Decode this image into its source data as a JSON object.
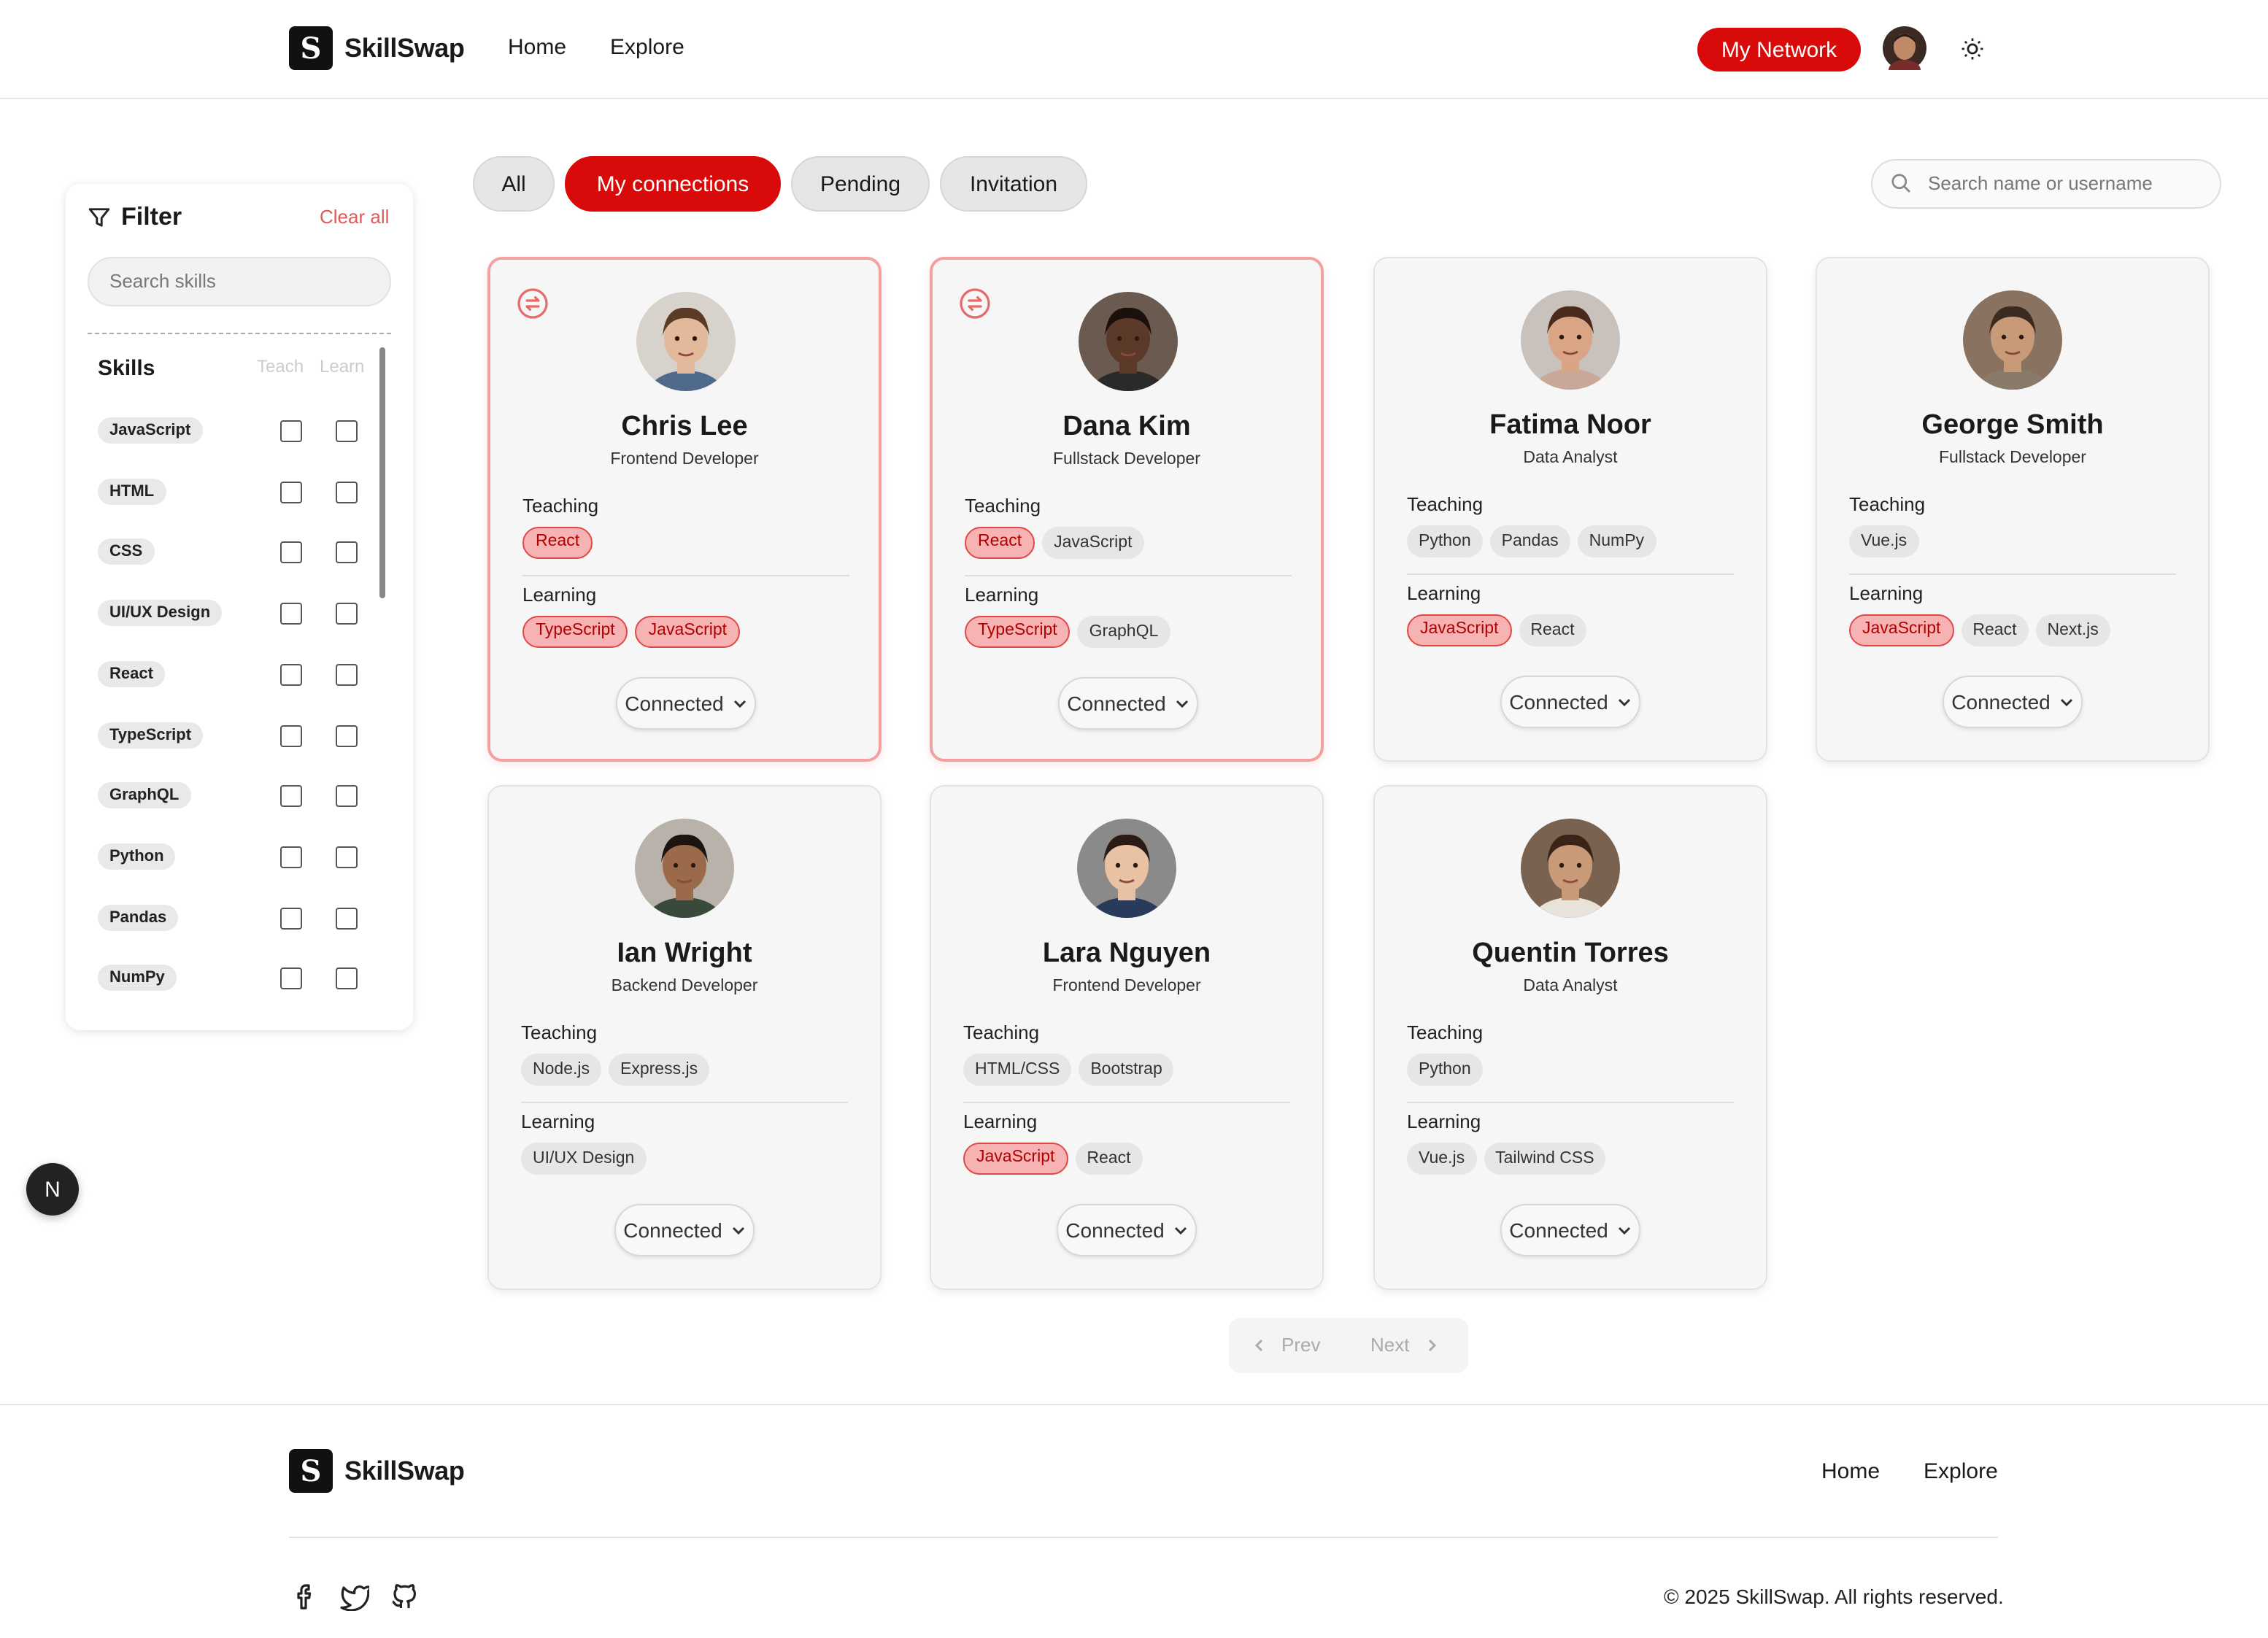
{
  "brand": {
    "logo_letter": "S",
    "name": "SkillSwap"
  },
  "header": {
    "nav": [
      "Home",
      "Explore"
    ],
    "network_button": "My Network",
    "accent": "#d90a0a"
  },
  "filter": {
    "title": "Filter",
    "clear_all": "Clear all",
    "search_placeholder": "Search skills",
    "skills_heading": "Skills",
    "col_teach": "Teach",
    "col_learn": "Learn",
    "skills": [
      "JavaScript",
      "HTML",
      "CSS",
      "UI/UX Design",
      "React",
      "TypeScript",
      "GraphQL",
      "Python",
      "Pandas",
      "NumPy"
    ]
  },
  "tabs": {
    "items": [
      "All",
      "My connections",
      "Pending",
      "Invitation"
    ],
    "active": "My connections"
  },
  "user_search": {
    "placeholder": "Search name or username"
  },
  "cards": [
    {
      "name": "Chris Lee",
      "role": "Frontend Developer",
      "highlighted": true,
      "teaching_label": "Teaching",
      "learning_label": "Learning",
      "teaching": [
        {
          "t": "React",
          "match": true
        }
      ],
      "learning": [
        {
          "t": "TypeScript",
          "match": true
        },
        {
          "t": "JavaScript",
          "match": true
        }
      ],
      "status": "Connected"
    },
    {
      "name": "Dana Kim",
      "role": "Fullstack Developer",
      "highlighted": true,
      "teaching_label": "Teaching",
      "learning_label": "Learning",
      "teaching": [
        {
          "t": "React",
          "match": true
        },
        {
          "t": "JavaScript",
          "match": false
        }
      ],
      "learning": [
        {
          "t": "TypeScript",
          "match": true
        },
        {
          "t": "GraphQL",
          "match": false
        }
      ],
      "status": "Connected"
    },
    {
      "name": "Fatima Noor",
      "role": "Data Analyst",
      "highlighted": false,
      "teaching_label": "Teaching",
      "learning_label": "Learning",
      "teaching": [
        {
          "t": "Python",
          "match": false
        },
        {
          "t": "Pandas",
          "match": false
        },
        {
          "t": "NumPy",
          "match": false
        }
      ],
      "learning": [
        {
          "t": "JavaScript",
          "match": true
        },
        {
          "t": "React",
          "match": false
        }
      ],
      "status": "Connected"
    },
    {
      "name": "George Smith",
      "role": "Fullstack Developer",
      "highlighted": false,
      "teaching_label": "Teaching",
      "learning_label": "Learning",
      "teaching": [
        {
          "t": "Vue.js",
          "match": false
        }
      ],
      "learning": [
        {
          "t": "JavaScript",
          "match": true
        },
        {
          "t": "React",
          "match": false
        },
        {
          "t": "Next.js",
          "match": false
        }
      ],
      "status": "Connected"
    },
    {
      "name": "Ian Wright",
      "role": "Backend Developer",
      "highlighted": false,
      "teaching_label": "Teaching",
      "learning_label": "Learning",
      "teaching": [
        {
          "t": "Node.js",
          "match": false
        },
        {
          "t": "Express.js",
          "match": false
        }
      ],
      "learning": [
        {
          "t": "UI/UX Design",
          "match": false
        }
      ],
      "status": "Connected"
    },
    {
      "name": "Lara Nguyen",
      "role": "Frontend Developer",
      "highlighted": false,
      "teaching_label": "Teaching",
      "learning_label": "Learning",
      "teaching": [
        {
          "t": "HTML/CSS",
          "match": false
        },
        {
          "t": "Bootstrap",
          "match": false
        }
      ],
      "learning": [
        {
          "t": "JavaScript",
          "match": true
        },
        {
          "t": "React",
          "match": false
        }
      ],
      "status": "Connected"
    },
    {
      "name": "Quentin Torres",
      "role": "Data Analyst",
      "highlighted": false,
      "teaching_label": "Teaching",
      "learning_label": "Learning",
      "teaching": [
        {
          "t": "Python",
          "match": false
        }
      ],
      "learning": [
        {
          "t": "Vue.js",
          "match": false
        },
        {
          "t": "Tailwind CSS",
          "match": false
        }
      ],
      "status": "Connected"
    }
  ],
  "pagination": {
    "prev": "Prev",
    "next": "Next"
  },
  "dev_indicator": "N",
  "footer": {
    "nav": [
      "Home",
      "Explore"
    ],
    "social_icons": [
      "facebook-icon",
      "twitter-icon",
      "github-icon"
    ],
    "copyright": "© 2025 SkillSwap. All rights reserved."
  }
}
